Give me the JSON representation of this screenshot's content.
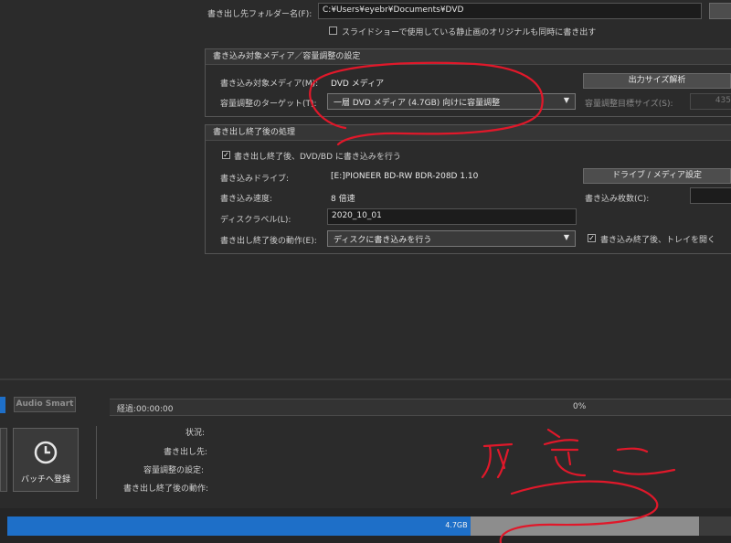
{
  "output": {
    "folder_label": "書き出し先フォルダー名(F):",
    "folder_value": "C:¥Users¥eyebr¥Documents¥DVD",
    "slideshow_checkbox_label": "スライドショーで使用している静止画のオリジナルも同時に書き出す",
    "slideshow_checked": false
  },
  "media_group": {
    "title": "書き込み対象メディア／容量調整の設定",
    "media_label": "書き込み対象メディア(M):",
    "media_value": "DVD メディア",
    "output_size_button": "出力サイズ解析",
    "target_label": "容量調整のターゲット(T):",
    "target_value": "一層 DVD メディア (4.7GB) 向けに容量調整",
    "target_size_label": "容量調整目標サイズ(S):",
    "target_size_value": "435"
  },
  "after_group": {
    "title": "書き出し終了後の処理",
    "write_checkbox_label": "書き出し終了後、DVD/BD に書き込みを行う",
    "write_checked": true,
    "drive_label": "書き込みドライブ:",
    "drive_value": "[E:]PIONEER BD-RW   BDR-208D 1.10",
    "drive_button": "ドライブ / メディア設定",
    "speed_label": "書き込み速度:",
    "speed_value": "8 倍速",
    "copies_label": "書き込み枚数(C):",
    "disc_label_label": "ディスクラベル(L):",
    "disc_label_value": "2020_10_01",
    "action_label": "書き出し終了後の動作(E):",
    "action_value": "ディスクに書き込みを行う",
    "tray_checkbox_label": "書き込み終了後、トレイを開く",
    "tray_checked": true
  },
  "bottom": {
    "audio_smart": "Audio Smart",
    "batch_button": "バッチへ登録",
    "elapsed": "経過:00:00:00",
    "percent": "0%",
    "status_label": "状況:",
    "dest_label": "書き出し先:",
    "capacity_label": "容量調整の設定:",
    "after_label": "書き出し終了後の動作:"
  },
  "capacity_bar": {
    "label": "4.7GB",
    "fill_fraction": 0.67,
    "accent": "#1e6fc8"
  },
  "checkmark": "✓",
  "dropdown_arrow": "▼"
}
